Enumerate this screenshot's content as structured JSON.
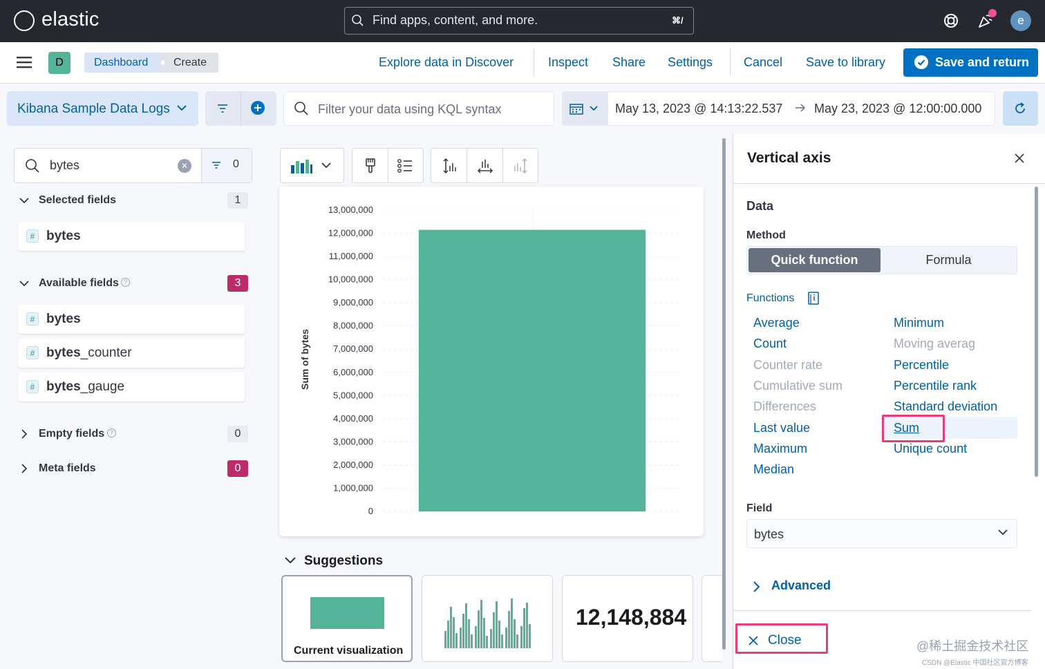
{
  "header": {
    "logo_text": "elastic",
    "search_placeholder": "Find apps, content, and more.",
    "search_shortcut": "⌘/",
    "avatar_initial": "e"
  },
  "nav": {
    "space_initial": "D",
    "breadcrumbs": [
      "Dashboard",
      "Create"
    ],
    "links": [
      "Explore data in Discover",
      "Inspect",
      "Share",
      "Settings",
      "Cancel",
      "Save to library"
    ],
    "primary_button": "Save and return"
  },
  "query_bar": {
    "data_view": "Kibana Sample Data Logs",
    "kql_placeholder": "Filter your data using KQL syntax",
    "date_start": "May 13, 2023 @ 14:13:22.537",
    "date_end": "May 23, 2023 @ 12:00:00.000"
  },
  "field_list": {
    "search_value": "bytes",
    "filter_count": "0",
    "sections": {
      "selected": {
        "title": "Selected fields",
        "count": "1",
        "fields": [
          {
            "match": "bytes",
            "rest": ""
          }
        ]
      },
      "available": {
        "title": "Available fields",
        "count": "3",
        "fields": [
          {
            "match": "bytes",
            "rest": ""
          },
          {
            "match": "bytes",
            "rest": "_counter"
          },
          {
            "match": "bytes",
            "rest": "_gauge"
          }
        ]
      },
      "empty": {
        "title": "Empty fields",
        "count": "0"
      },
      "meta": {
        "title": "Meta fields",
        "count": "0"
      }
    },
    "field_type_glyph": "#"
  },
  "chart_data": {
    "type": "bar",
    "categories": [
      ""
    ],
    "values": [
      12148884
    ],
    "ylabel": "Sum of bytes",
    "ylim": [
      0,
      13000000
    ],
    "yticks": [
      "13,000,000",
      "12,000,000",
      "11,000,000",
      "10,000,000",
      "9,000,000",
      "8,000,000",
      "7,000,000",
      "6,000,000",
      "5,000,000",
      "4,000,000",
      "3,000,000",
      "2,000,000",
      "1,000,000",
      "0"
    ],
    "bar_color": "#54b399",
    "grid": true
  },
  "suggestions": {
    "title": "Suggestions",
    "current_label": "Current visualization",
    "metric_value": "12,148,884"
  },
  "flyout": {
    "title": "Vertical axis",
    "section": "Data",
    "method_label": "Method",
    "method_options": [
      "Quick function",
      "Formula"
    ],
    "functions_label": "Functions",
    "functions_left": [
      {
        "label": "Average",
        "enabled": true
      },
      {
        "label": "Count",
        "enabled": true
      },
      {
        "label": "Counter rate",
        "enabled": false
      },
      {
        "label": "Cumulative sum",
        "enabled": false
      },
      {
        "label": "Differences",
        "enabled": false
      },
      {
        "label": "Last value",
        "enabled": true
      },
      {
        "label": "Maximum",
        "enabled": true
      },
      {
        "label": "Median",
        "enabled": true
      }
    ],
    "functions_right": [
      {
        "label": "Minimum",
        "enabled": true
      },
      {
        "label": "Moving averag",
        "enabled": false
      },
      {
        "label": "Percentile",
        "enabled": true
      },
      {
        "label": "Percentile rank",
        "enabled": true
      },
      {
        "label": "Standard deviation",
        "enabled": true
      },
      {
        "label": "Sum",
        "enabled": true,
        "selected": true
      },
      {
        "label": "Unique count",
        "enabled": true
      }
    ],
    "field_label": "Field",
    "field_value": "bytes",
    "advanced_label": "Advanced",
    "close_label": "Close"
  },
  "watermark": "@稀土掘金技术社区",
  "watermark_small": "CSDN @Elastic 中国社区官方博客",
  "colors": {
    "accent": "#0071c2",
    "link": "#0061a6",
    "highlight": "#ea3c7a",
    "vis": "#54b399"
  }
}
